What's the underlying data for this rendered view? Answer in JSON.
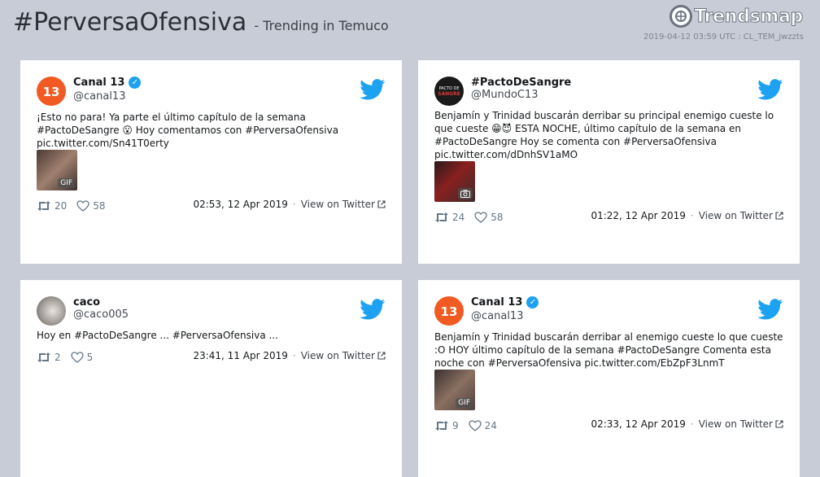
{
  "header": {
    "hashtag": "#PerversaOfensiva",
    "trending": "- Trending in Temuco",
    "brand": "Trendsmap",
    "meta": "2019-04-12 03:59 UTC : CL_TEM_jwzzts"
  },
  "colors": {
    "twitter_blue": "#1da1f2",
    "card_bg": "#ffffff",
    "page_bg": "#c8ccd6",
    "canal13": "#f15a22"
  },
  "tweets": [
    {
      "name": "Canal 13",
      "verified": true,
      "handle": "@canal13",
      "text": "¡Esto no para! Ya parte el último capítulo de la semana\n#PactoDeSangre 😮 Hoy comentamos con #PerversaOfensiva\npic.twitter.com/Sn41T0erty",
      "media_badge": "GIF",
      "retweets": "20",
      "likes": "58",
      "time": "02:53, 12 Apr 2019",
      "view": "View on Twitter"
    },
    {
      "name": "#PactoDeSangre",
      "verified": false,
      "handle": "@MundoC13",
      "text": "Benjamín y Trinidad buscarán derribar su principal enemigo cueste lo\nque cueste 😁😈 ESTA NOCHE, último capítulo de la semana en\n#PactoDeSangre  Hoy se comenta con   #PerversaOfensiva\npic.twitter.com/dDnhSV1aMO",
      "media_badge": "camera-icon",
      "retweets": "24",
      "likes": "58",
      "time": "01:22, 12 Apr 2019",
      "view": "View on Twitter"
    },
    {
      "name": "caco",
      "verified": false,
      "handle": "@caco005",
      "text": "Hoy en #PactoDeSangre ... #PerversaOfensiva ...",
      "media_badge": "",
      "retweets": "2",
      "likes": "5",
      "time": "23:41, 11 Apr 2019",
      "view": "View on Twitter"
    },
    {
      "name": "Canal 13",
      "verified": true,
      "handle": "@canal13",
      "text": "Benjamín y Trinidad buscarán derribar al enemigo cueste lo que cueste\n:O HOY último capítulo de la semana #PactoDeSangre Comenta esta\nnoche con #PerversaOfensiva pic.twitter.com/EbZpF3LnmT",
      "media_badge": "GIF",
      "retweets": "9",
      "likes": "24",
      "time": "02:33, 12 Apr 2019",
      "view": "View on Twitter"
    }
  ]
}
